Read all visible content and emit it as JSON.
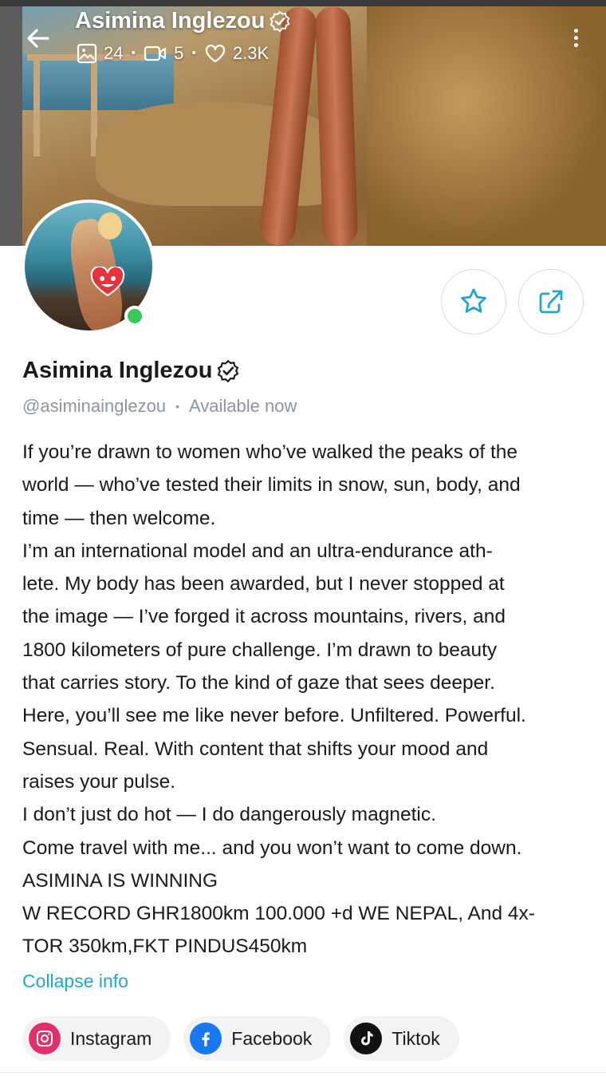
{
  "header": {
    "title": "Asimina Inglezou",
    "stats": {
      "photos": "24",
      "videos": "5",
      "likes": "2.3K"
    },
    "icons": {
      "back": "arrow-left-icon",
      "photos": "image-icon",
      "videos": "video-icon",
      "likes": "heart-icon",
      "more": "more-vertical-icon",
      "verified": "verified-badge-icon"
    }
  },
  "profile": {
    "name": "Asimina Inglezou",
    "handle": "@asiminainglezou",
    "separator": "•",
    "status": "Available now",
    "online": true,
    "actions": {
      "favorite_icon": "star-icon",
      "share_icon": "share-icon"
    }
  },
  "bio": {
    "lines": [
      "If you’re drawn to women who’ve walked the peaks of the",
      "world — who’ve tested their limits in snow, sun, body, and",
      "time — then welcome.",
      "I’m an international model and an ultra-endurance ath-",
      "lete. My body has been awarded, but I never stopped at",
      "the image — I’ve forged it across mountains, rivers, and",
      "1800 kilometers of pure challenge. I’m drawn to beauty",
      "that carries story. To the kind of gaze that sees deeper.",
      "Here, you’ll see me like never before. Unfiltered. Powerful.",
      "Sensual. Real. With content that shifts your mood and",
      "raises your pulse.",
      "I don’t just do hot — I do dangerously magnetic.",
      "Come travel with me... and you won’t want to come down.",
      "ASIMINA IS WINNING",
      "W RECORD GHR1800km 100.000 +d WE NEPAL, And 4x-",
      "TOR 350km,FKT PINDUS450km"
    ],
    "collapse_label": "Collapse info"
  },
  "socials": [
    {
      "label": "Instagram",
      "icon": "instagram-icon",
      "color": "#e1306c"
    },
    {
      "label": "Facebook",
      "icon": "facebook-icon",
      "color": "#1877f2"
    },
    {
      "label": "Tiktok",
      "icon": "tiktok-icon",
      "color": "#111111"
    }
  ],
  "colors": {
    "accent": "#1fa7d1",
    "online": "#34c759",
    "muted": "#8a96a3"
  }
}
